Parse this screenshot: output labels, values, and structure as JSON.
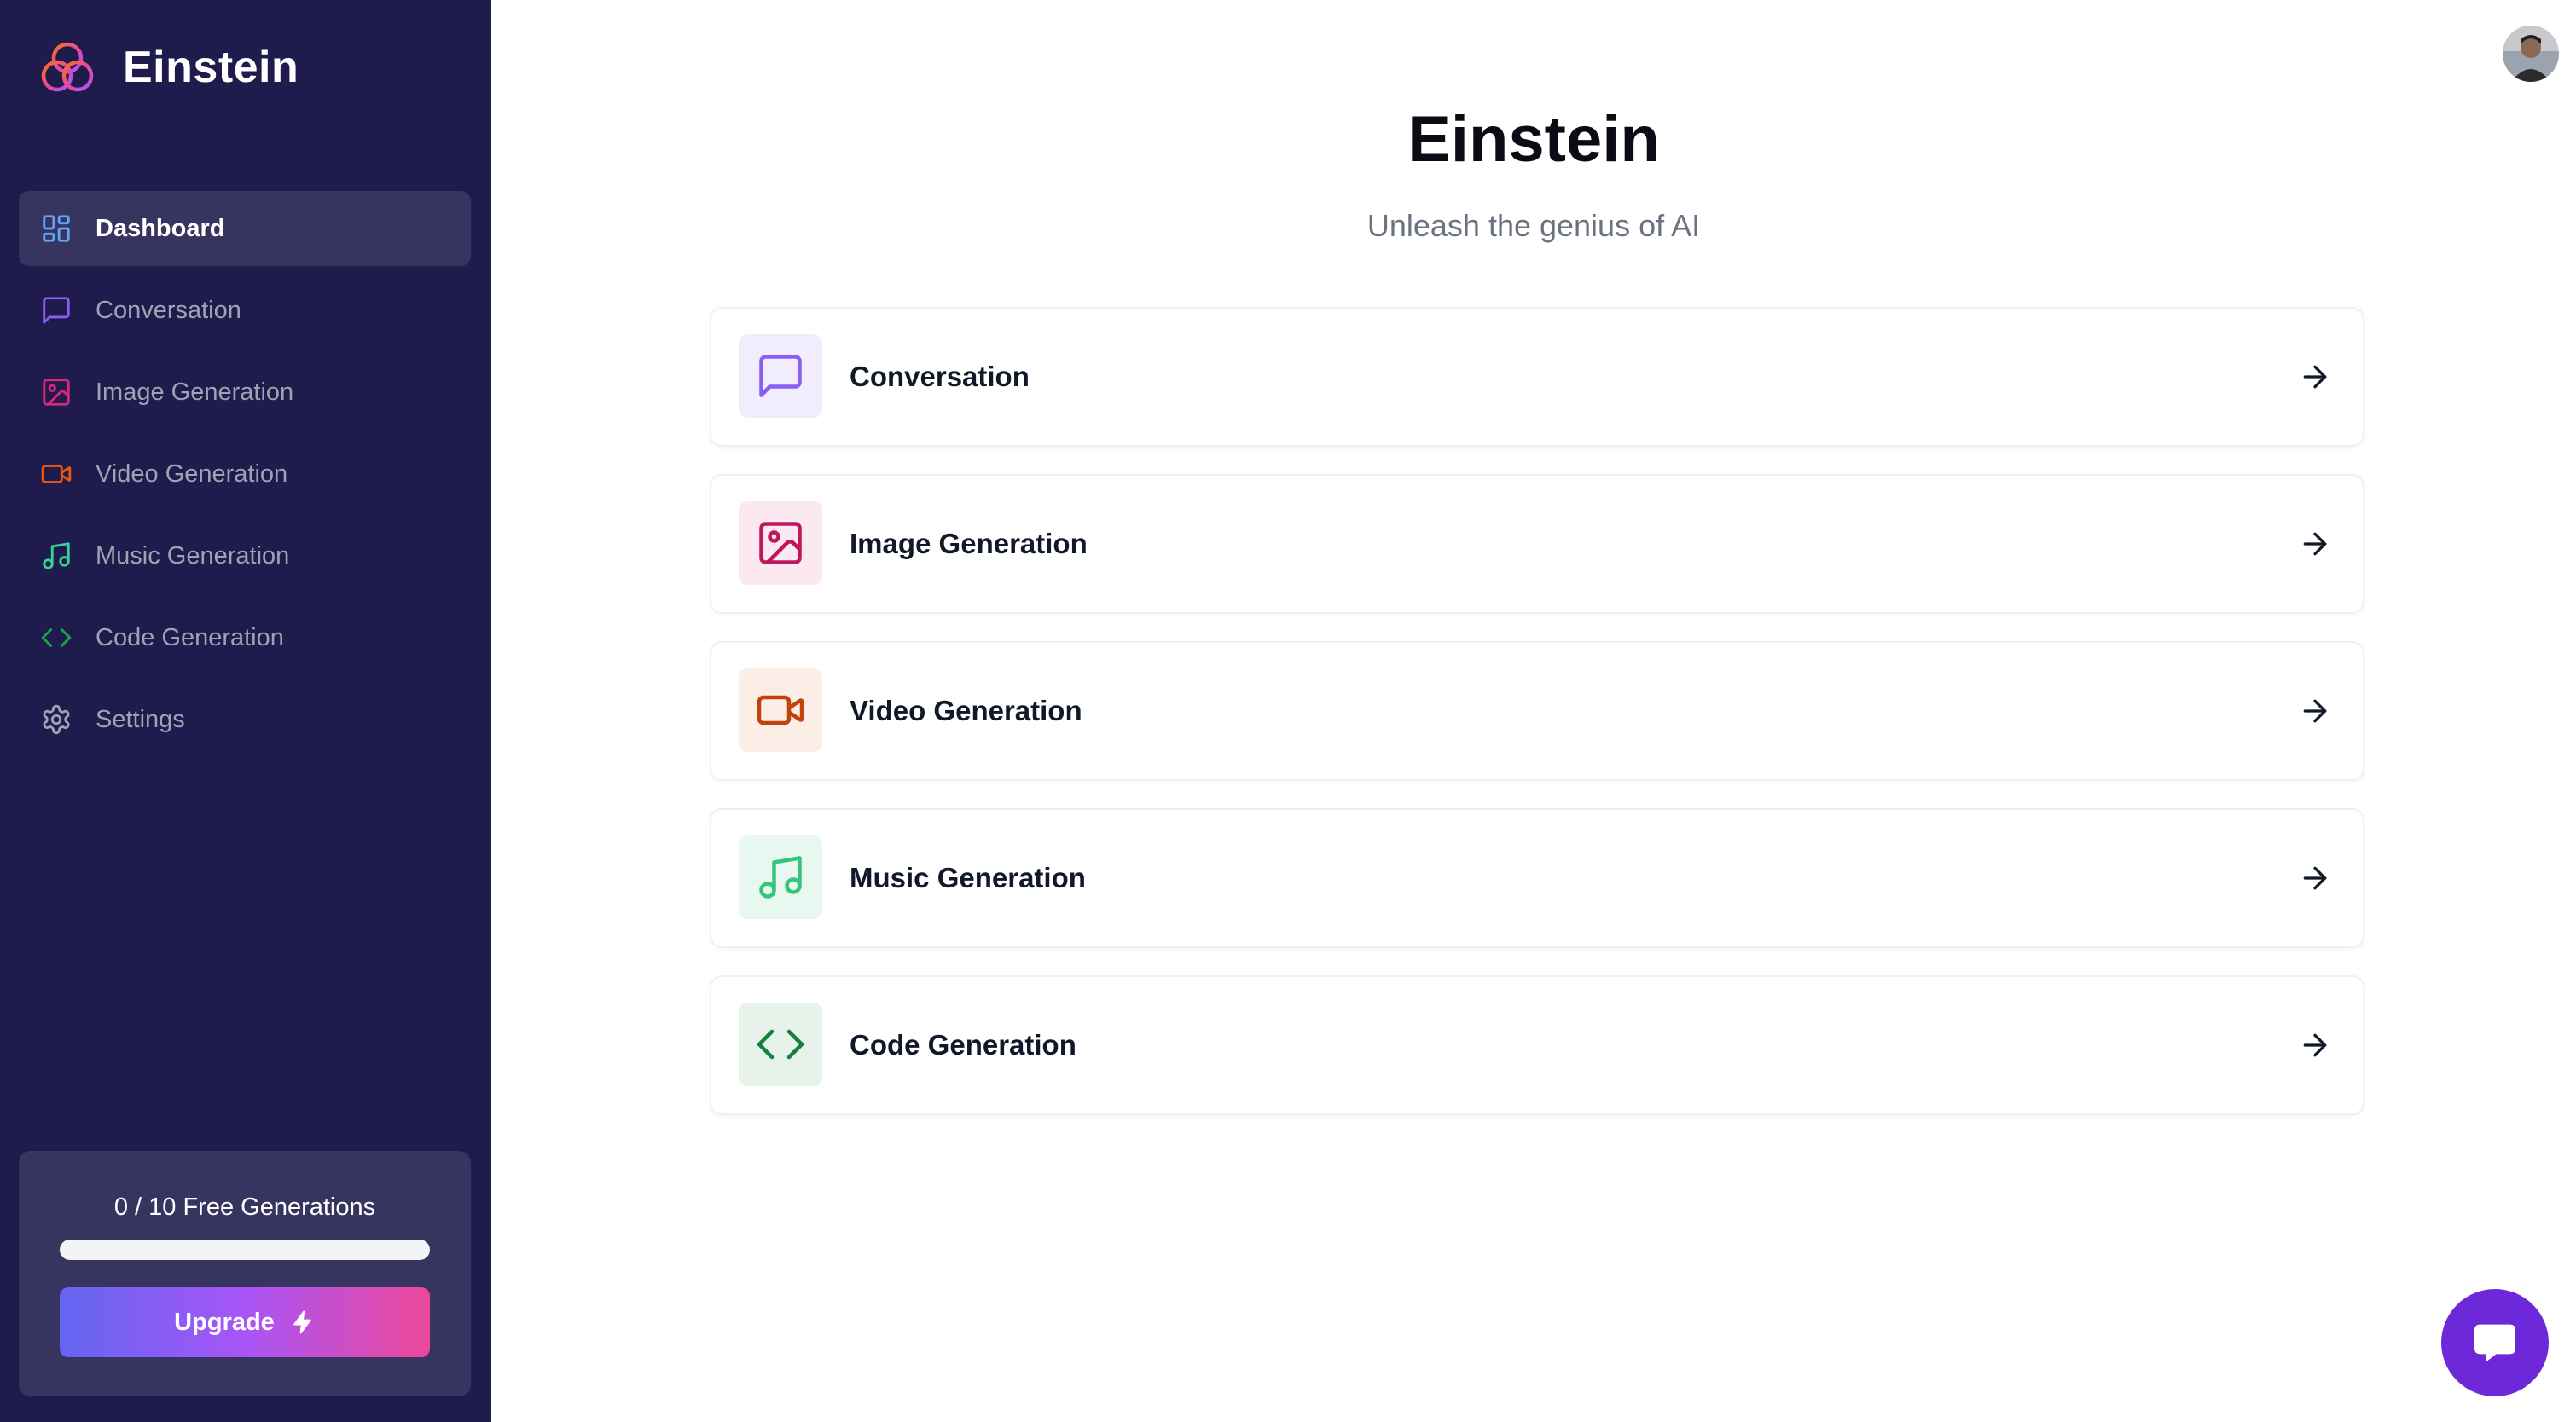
{
  "sidebar": {
    "brand": "Einstein",
    "items": [
      {
        "label": "Dashboard",
        "icon": "layout-grid-icon",
        "color": "#60a5fa",
        "active": true
      },
      {
        "label": "Conversation",
        "icon": "message-square-icon",
        "color": "#8b5cf6",
        "active": false
      },
      {
        "label": "Image Generation",
        "icon": "image-icon",
        "color": "#db2777",
        "active": false
      },
      {
        "label": "Video Generation",
        "icon": "video-icon",
        "color": "#ea580c",
        "active": false
      },
      {
        "label": "Music Generation",
        "icon": "music-icon",
        "color": "#34d399",
        "active": false
      },
      {
        "label": "Code Generation",
        "icon": "code-icon",
        "color": "#16a34a",
        "active": false
      },
      {
        "label": "Settings",
        "icon": "settings-icon",
        "color": "#a1a1b5",
        "active": false
      }
    ],
    "usage": {
      "text": "0 / 10 Free Generations",
      "used": 0,
      "limit": 10,
      "upgrade_label": "Upgrade"
    }
  },
  "main": {
    "title": "Einstein",
    "subtitle": "Unleash the genius of AI",
    "cards": [
      {
        "label": "Conversation",
        "icon": "message-square-icon",
        "color": "#8b5cf6",
        "bg": "#f1edfd"
      },
      {
        "label": "Image Generation",
        "icon": "image-icon",
        "color": "#be185d",
        "bg": "#fbe9ef"
      },
      {
        "label": "Video Generation",
        "icon": "video-icon",
        "color": "#c2410c",
        "bg": "#fbeee7"
      },
      {
        "label": "Music Generation",
        "icon": "music-icon",
        "color": "#34c77b",
        "bg": "#e8f7ef"
      },
      {
        "label": "Code Generation",
        "icon": "code-icon",
        "color": "#15803d",
        "bg": "#e7f3ea"
      }
    ]
  },
  "colors": {
    "sidebar_bg": "#1f1c4d",
    "sidebar_active": "#37345f",
    "chat_button": "#6d28d9"
  }
}
